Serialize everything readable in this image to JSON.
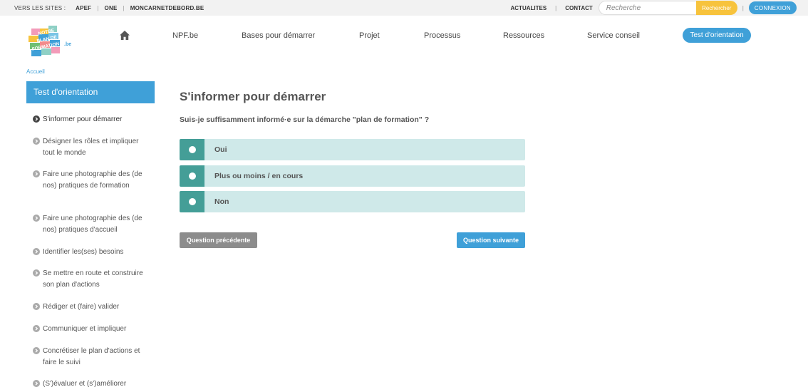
{
  "topbar": {
    "sites_label": "VERS LES SITES :",
    "sites": [
      "APEF",
      "ONE",
      "MONCARNETDEBORD.BE"
    ],
    "links": [
      "ACTUALITES",
      "CONTACT"
    ],
    "search_placeholder": "Recherche",
    "search_button": "Recherche r",
    "connexion": "CONNEXION"
  },
  "logo": {
    "lines": [
      "NOTRE",
      "PLAN DE",
      "FORMATION",
      ".be"
    ]
  },
  "nav": {
    "items": [
      "NPF.be",
      "Bases pour démarrer",
      "Projet",
      "Processus",
      "Ressources",
      "Service conseil"
    ],
    "cta": "Test d'orientation"
  },
  "breadcrumb": "Accueil",
  "sidebar": {
    "title": "Test d'orientation",
    "items": [
      "S'informer pour démarrer",
      "Désigner les rôles et impliquer tout le monde",
      "Faire une photographie des (de nos) pratiques de formation",
      "Faire une photographie des (de nos) pratiques d'accueil",
      "Identifier les(ses) besoins",
      "Se mettre en route et construire son plan d'actions",
      "Rédiger et (faire) valider",
      "Communiquer et impliquer",
      "Concrétiser le plan d'actions et faire le suivi",
      "(S')évaluer et (s')améliorer"
    ]
  },
  "main": {
    "title": "S'informer pour démarrer",
    "question": "Suis-je suffisamment informé·e sur la démarche \"plan de formation\" ?",
    "answers": [
      "Oui",
      "Plus ou moins / en cours",
      "Non"
    ],
    "prev_button": "Question précédente",
    "next_button": "Question suivante"
  },
  "colors": {
    "accent": "#3fa0d8",
    "search_button": "#f7c33d",
    "answer_bg": "#cfe9e9",
    "answer_radio": "#449e97",
    "prev_button": "#8c8c8c"
  }
}
